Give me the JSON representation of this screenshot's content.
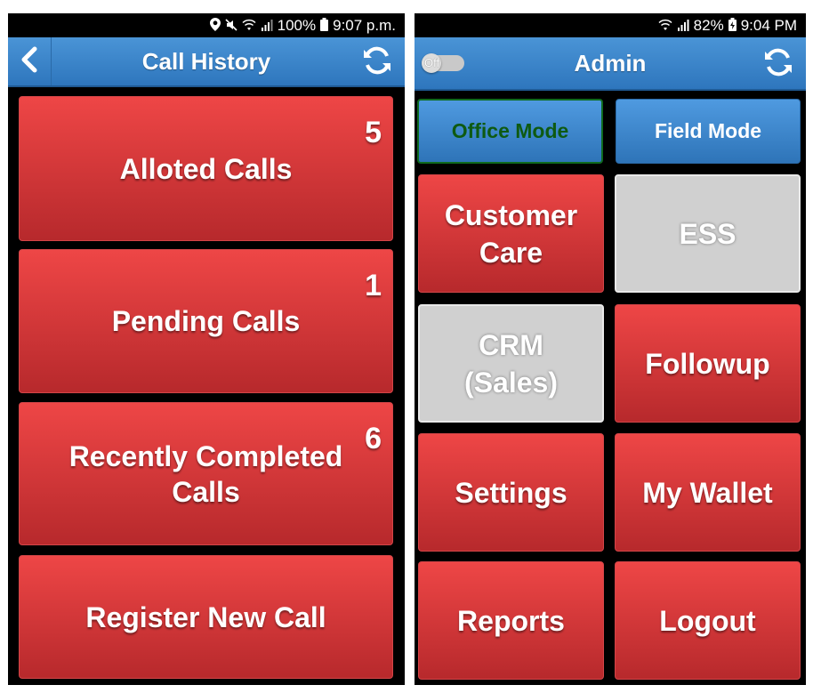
{
  "left_screen": {
    "status_bar": {
      "icons": [
        "location-icon",
        "mute-icon",
        "wifi-icon",
        "signal-icon",
        "battery-icon"
      ],
      "battery": "100%",
      "time": "9:07 p.m."
    },
    "app_bar": {
      "back_icon": "chevron-left-icon",
      "title": "Call History",
      "refresh_icon": "refresh-icon"
    },
    "items": [
      {
        "label": "Alloted Calls",
        "count": "5"
      },
      {
        "label": "Pending Calls",
        "count": "1"
      },
      {
        "label": "Recently Completed Calls",
        "count": "6"
      },
      {
        "label": "Register New Call",
        "count": ""
      }
    ]
  },
  "right_screen": {
    "status_bar": {
      "icons": [
        "wifi-icon",
        "signal-icon",
        "battery-charging-icon"
      ],
      "battery": "82%",
      "time": "9:04 PM"
    },
    "app_bar": {
      "toggle_label": "Off",
      "title": "Admin",
      "refresh_icon": "refresh-icon"
    },
    "modes": {
      "office": "Office Mode",
      "field": "Field Mode"
    },
    "tiles": {
      "customer_care": "Customer Care",
      "ess": "ESS",
      "crm": "CRM (Sales)",
      "followup": "Followup",
      "settings": "Settings",
      "my_wallet": "My Wallet",
      "reports": "Reports",
      "logout": "Logout"
    }
  },
  "colors": {
    "app_bar": "#3c86cc",
    "red_button": "#d83a3c",
    "disabled_tile": "#d0d0d0",
    "office_mode_text": "#0e5a12"
  }
}
